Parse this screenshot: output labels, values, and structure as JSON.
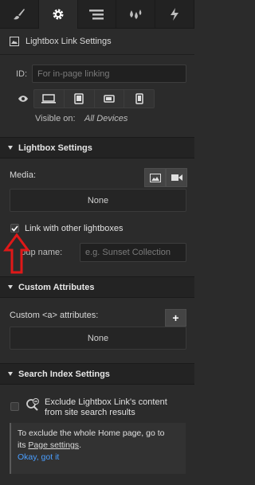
{
  "tabs": [
    "brush-icon",
    "gear-icon",
    "list-icon",
    "drops-icon",
    "bolt-icon"
  ],
  "element": {
    "title": "Lightbox Link Settings"
  },
  "id_field": {
    "label": "ID:",
    "placeholder": "For in-page linking"
  },
  "visibility": {
    "label": "Visible on:",
    "value": "All Devices"
  },
  "lightbox": {
    "heading": "Lightbox Settings",
    "media_label": "Media:",
    "media_value": "None",
    "link_label": "Link with other lightboxes",
    "link_checked": true,
    "group_label": "Group name:",
    "group_placeholder": "e.g. Sunset Collection"
  },
  "custom_attrs": {
    "heading": "Custom Attributes",
    "label": "Custom <a> attributes:",
    "value": "None",
    "add_label": "+"
  },
  "search_index": {
    "heading": "Search Index Settings",
    "exclude_line1": "Exclude Lightbox Link's content",
    "exclude_line2": "from site search results",
    "notice_line1": "To exclude the whole Home page, go to",
    "notice_its": "its",
    "notice_link": "Page settings",
    "notice_period": ".",
    "notice_ok": "Okay, got it"
  },
  "colors": {
    "accent": "#4a9eff",
    "arrow": "#e01818",
    "panel": "#2b2b2b"
  }
}
